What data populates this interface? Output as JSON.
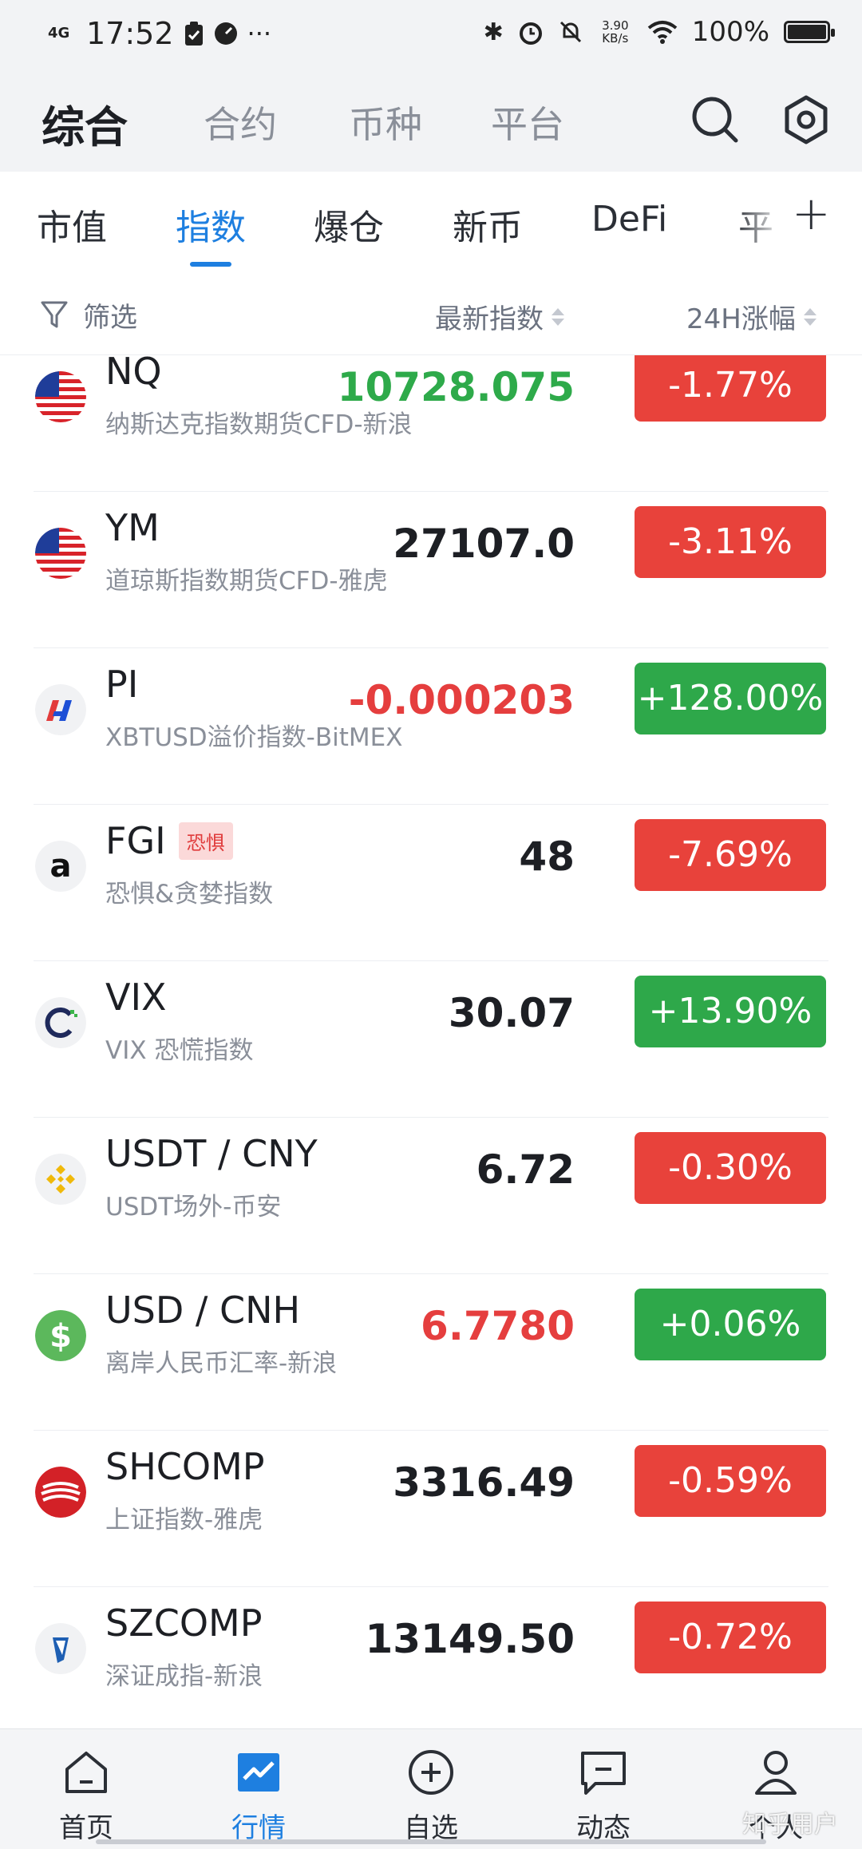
{
  "status_bar": {
    "network": "4G",
    "time": "17:52",
    "speed": "3.90\nKB/s",
    "battery": "100%",
    "battery_level": 1.0
  },
  "top_nav": {
    "tabs": [
      {
        "label": "综合",
        "active": true
      },
      {
        "label": "合约",
        "active": false
      },
      {
        "label": "币种",
        "active": false
      },
      {
        "label": "平台",
        "active": false
      }
    ],
    "search_icon": "search-icon",
    "settings_icon": "hexagon-settings-icon"
  },
  "sub_tabs": {
    "tabs": [
      {
        "label": "市值",
        "active": false
      },
      {
        "label": "指数",
        "active": true
      },
      {
        "label": "爆仓",
        "active": false
      },
      {
        "label": "新币",
        "active": false
      },
      {
        "label": "DeFi",
        "active": false
      },
      {
        "label": "平",
        "active": false
      }
    ],
    "add_label": "+"
  },
  "list_header": {
    "filter_label": "筛选",
    "price_col": "最新指数",
    "change_col": "24H涨幅"
  },
  "rows": [
    {
      "symbol": "NQ",
      "desc": "纳斯达克指数期货CFD-新浪",
      "price": "10728.075",
      "price_color": "green",
      "change": "-1.77%",
      "direction": "down",
      "logo": "us-flag-icon"
    },
    {
      "symbol": "YM",
      "desc": "道琼斯指数期货CFD-雅虎",
      "price": "27107.0",
      "price_color": "default",
      "change": "-3.11%",
      "direction": "down",
      "logo": "us-flag-icon"
    },
    {
      "symbol": "PI",
      "desc": "XBTUSD溢价指数-BitMEX",
      "price": "-0.000203",
      "price_color": "red",
      "change": "+128.00%",
      "direction": "up",
      "logo": "bitmex-icon"
    },
    {
      "symbol": "FGI",
      "tag": "恐惧",
      "desc": "恐惧&贪婪指数",
      "price": "48",
      "price_color": "default",
      "change": "-7.69%",
      "direction": "down",
      "logo": "alternative-me-icon"
    },
    {
      "symbol": "VIX",
      "desc": "VIX 恐慌指数",
      "price": "30.07",
      "price_color": "default",
      "change": "+13.90%",
      "direction": "up",
      "logo": "cboe-icon"
    },
    {
      "symbol": "USDT / CNY",
      "desc": "USDT场外-币安",
      "price": "6.72",
      "price_color": "default",
      "change": "-0.30%",
      "direction": "down",
      "logo": "binance-icon"
    },
    {
      "symbol": "USD / CNH",
      "desc": "离岸人民币汇率-新浪",
      "price": "6.7780",
      "price_color": "red",
      "change": "+0.06%",
      "direction": "up",
      "logo": "dollar-icon"
    },
    {
      "symbol": "SHCOMP",
      "desc": "上证指数-雅虎",
      "price": "3316.49",
      "price_color": "default",
      "change": "-0.59%",
      "direction": "down",
      "logo": "sse-icon"
    },
    {
      "symbol": "SZCOMP",
      "desc": "深证成指-新浪",
      "price": "13149.50",
      "price_color": "default",
      "change": "-0.72%",
      "direction": "down",
      "logo": "szse-icon"
    }
  ],
  "bottom_nav": {
    "items": [
      {
        "label": "首页",
        "icon": "home-icon",
        "active": false
      },
      {
        "label": "行情",
        "icon": "market-chart-icon",
        "active": true
      },
      {
        "label": "自选",
        "icon": "add-favorite-icon",
        "active": false
      },
      {
        "label": "动态",
        "icon": "message-icon",
        "active": false
      },
      {
        "label": "个人",
        "icon": "user-icon",
        "active": false
      }
    ]
  },
  "watermark": "知乎用户",
  "colors": {
    "accent": "#1e7fe0",
    "up": "#2ea84a",
    "down": "#e8423b"
  }
}
